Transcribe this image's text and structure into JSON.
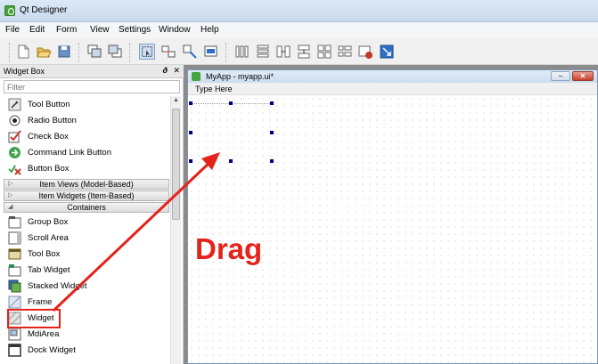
{
  "app": {
    "title": "Qt Designer"
  },
  "menu": [
    "File",
    "Edit",
    "Form",
    "View",
    "Settings",
    "Window",
    "Help"
  ],
  "widget_box": {
    "title": "Widget Box",
    "controls": "ฅ ✕",
    "filter_placeholder": "Filter",
    "items_top": [
      "Tool Button",
      "Radio Button",
      "Check Box",
      "Command Link Button",
      "Button Box"
    ],
    "categories": [
      "Item Views (Model-Based)",
      "Item Widgets (Item-Based)",
      "Containers"
    ],
    "items_containers": [
      "Group Box",
      "Scroll Area",
      "Tool Box",
      "Tab Widget",
      "Stacked Widget",
      "Frame",
      "Widget",
      "MdiArea",
      "Dock Widget"
    ]
  },
  "form": {
    "title": "MyApp - myapp.ui*",
    "menu_placeholder": "Type Here",
    "min_glyph": "–",
    "close_glyph": "✕"
  },
  "annotation": {
    "label": "Drag",
    "color": "#e4231a"
  },
  "colors": {
    "accent": "#e4231a",
    "handle": "#00008b",
    "qt_green": "#44a63c"
  }
}
